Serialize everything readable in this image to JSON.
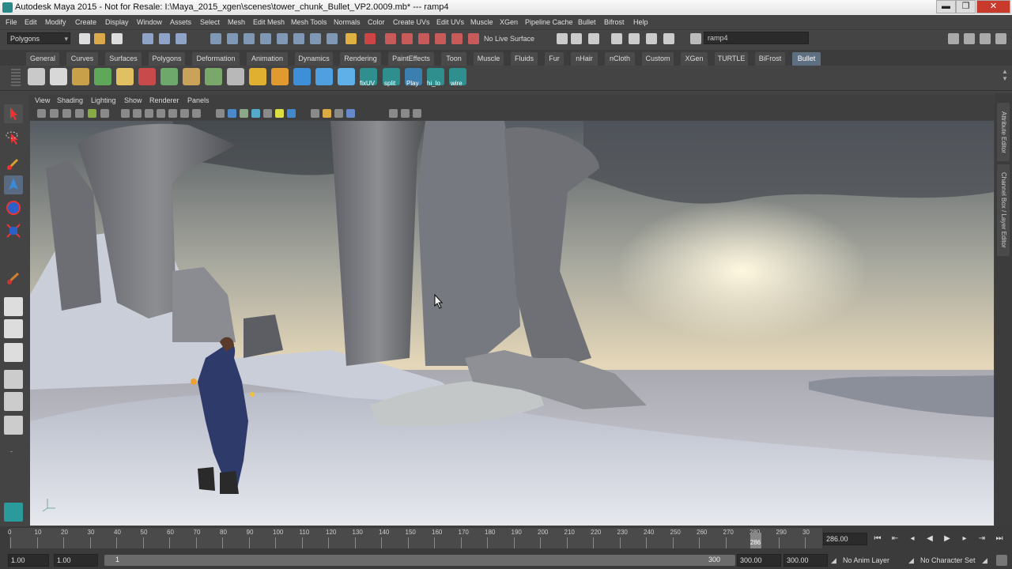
{
  "window": {
    "title": "Autodesk Maya 2015 - Not for Resale: I:\\Maya_2015_xgen\\scenes\\tower_chunk_Bullet_VP2.0009.mb*   ---   ramp4",
    "minimize": "▬",
    "maximize": "❐",
    "close": "✕"
  },
  "menubar": [
    "File",
    "Edit",
    "Modify",
    "Create",
    "Display",
    "Window",
    "Assets",
    "Select",
    "Mesh",
    "Edit Mesh",
    "Mesh Tools",
    "Normals",
    "Color",
    "Create UVs",
    "Edit UVs",
    "Muscle",
    "XGen",
    "Pipeline Cache",
    "Bullet",
    "Bifrost",
    "Help"
  ],
  "statusline": {
    "menu_set": "Polygons",
    "live_surface": "No Live Surface",
    "name_field": "ramp4"
  },
  "shelf_tabs": [
    "General",
    "Curves",
    "Surfaces",
    "Polygons",
    "Deformation",
    "Animation",
    "Dynamics",
    "Rendering",
    "PaintEffects",
    "Toon",
    "Muscle",
    "Fluids",
    "Fur",
    "nHair",
    "nCloth",
    "Custom",
    "XGen",
    "TURTLE",
    "BiFrost",
    "Bullet"
  ],
  "shelf_active": "Bullet",
  "shelf_labels": [
    "fixUV",
    "split",
    "Play",
    "hi_lo",
    "wire"
  ],
  "panel_menu": [
    "View",
    "Shading",
    "Lighting",
    "Show",
    "Renderer",
    "Panels"
  ],
  "right_dock": {
    "attribute_editor": "Attribute Editor",
    "channel_box": "Channel Box / Layer Editor"
  },
  "timeline": {
    "ticks": [
      "0",
      "10",
      "20",
      "30",
      "40",
      "50",
      "60",
      "70",
      "80",
      "90",
      "100",
      "110",
      "120",
      "130",
      "140",
      "150",
      "160",
      "170",
      "180",
      "190",
      "200",
      "210",
      "220",
      "230",
      "240",
      "250",
      "260",
      "270",
      "280",
      "290",
      "30"
    ],
    "current_frame_label": "286",
    "current_frame_field": "286.00"
  },
  "range": {
    "start_time": "1.00",
    "playback_start": "1.00",
    "range_start": "1",
    "range_end": "300",
    "playback_end": "300.00",
    "end_time": "300.00",
    "anim_layer": "No Anim Layer",
    "character_set": "No Character Set"
  },
  "playback_icons": [
    "skip-to-start-icon",
    "step-back-key-icon",
    "step-back-icon",
    "play-back-icon",
    "play-forward-icon",
    "step-forward-icon",
    "step-forward-key-icon",
    "skip-to-end-icon"
  ],
  "colors": {
    "active_tab": "#5e6f82",
    "ui_bg": "#444444",
    "close_button": "#c83a2b"
  }
}
